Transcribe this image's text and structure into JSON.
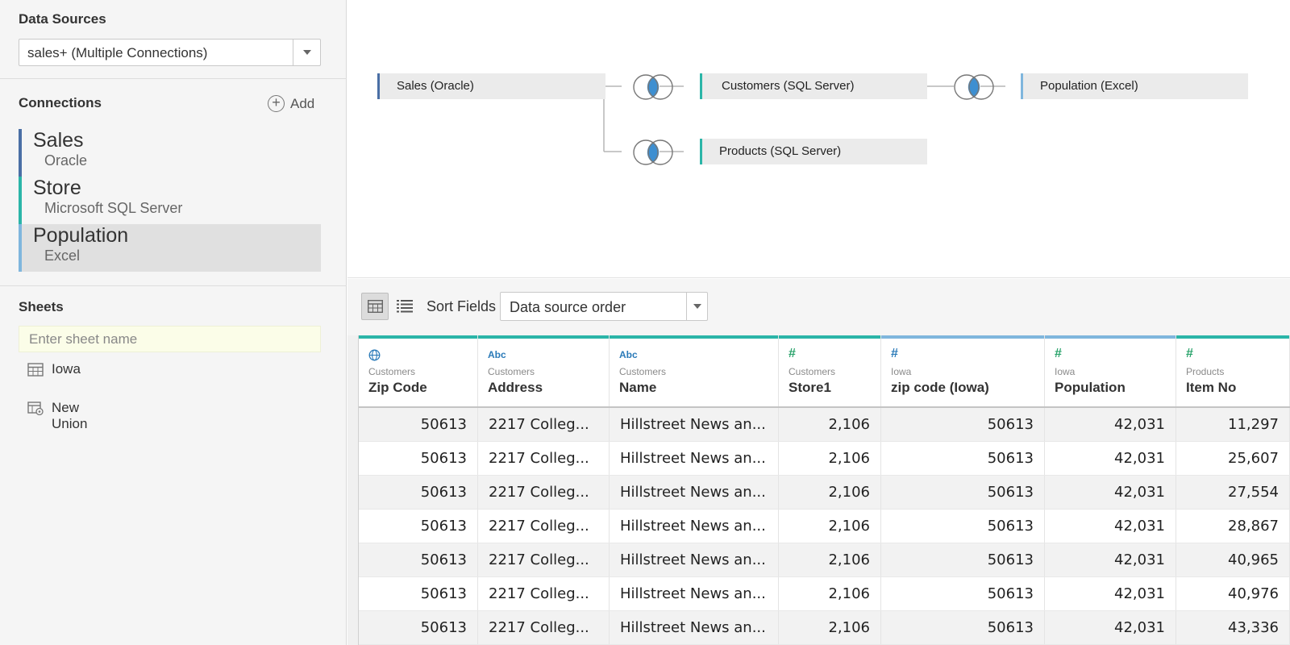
{
  "data_sources": {
    "title": "Data Sources",
    "selected": "sales+ (Multiple Connections)"
  },
  "connections": {
    "title": "Connections",
    "add_label": "Add",
    "items": [
      {
        "name": "Sales",
        "type": "Oracle",
        "color": "#4a6fa5",
        "selected": false
      },
      {
        "name": "Store",
        "type": "Microsoft SQL Server",
        "color": "#2bb5a8",
        "selected": false
      },
      {
        "name": "Population",
        "type": "Excel",
        "color": "#7fb6dd",
        "selected": true
      }
    ]
  },
  "sheets": {
    "title": "Sheets",
    "placeholder": "Enter sheet name",
    "items": [
      {
        "label": "Iowa",
        "icon": "table-icon"
      },
      {
        "label": "New Union",
        "icon": "union-icon"
      }
    ]
  },
  "join_canvas": {
    "tables": [
      {
        "label": "Sales (Oracle)",
        "color": "#4a6fa5"
      },
      {
        "label": "Customers (SQL Server)",
        "color": "#2bb5a8"
      },
      {
        "label": "Population (Excel)",
        "color": "#7fb6dd"
      },
      {
        "label": "Products (SQL Server)",
        "color": "#2bb5a8"
      }
    ],
    "join_icon": "inner-join-icon"
  },
  "toolbar": {
    "sort_label": "Sort Fields",
    "sort_value": "Data source order",
    "grid_icon": "grid-view-icon",
    "list_icon": "list-view-icon"
  },
  "grid": {
    "columns": [
      {
        "source": "Customers",
        "name": "Zip Code",
        "type": "globe",
        "type_label": "",
        "bar": "#2bb5a8",
        "type_color": "#2a7ab8"
      },
      {
        "source": "Customers",
        "name": "Address",
        "type": "abc",
        "type_label": "Abc",
        "bar": "#2bb5a8",
        "type_color": "#2a7ab8"
      },
      {
        "source": "Customers",
        "name": "Name",
        "type": "abc",
        "type_label": "Abc",
        "bar": "#2bb5a8",
        "type_color": "#2a7ab8"
      },
      {
        "source": "Customers",
        "name": "Store1",
        "type": "number",
        "type_label": "#",
        "bar": "#2bb5a8",
        "type_color": "#2aa36b"
      },
      {
        "source": "Iowa",
        "name": "zip code (Iowa)",
        "type": "number",
        "type_label": "#",
        "bar": "#7fb6dd",
        "type_color": "#2a7ab8"
      },
      {
        "source": "Iowa",
        "name": "Population",
        "type": "number",
        "type_label": "#",
        "bar": "#7fb6dd",
        "type_color": "#2aa36b"
      },
      {
        "source": "Products",
        "name": "Item No",
        "type": "number",
        "type_label": "#",
        "bar": "#2bb5a8",
        "type_color": "#2aa36b"
      }
    ],
    "rows": [
      [
        "50613",
        "2217 Colleg...",
        "Hillstreet News an...",
        "2,106",
        "50613",
        "42,031",
        "11,297"
      ],
      [
        "50613",
        "2217 Colleg...",
        "Hillstreet News an...",
        "2,106",
        "50613",
        "42,031",
        "25,607"
      ],
      [
        "50613",
        "2217 Colleg...",
        "Hillstreet News an...",
        "2,106",
        "50613",
        "42,031",
        "27,554"
      ],
      [
        "50613",
        "2217 Colleg...",
        "Hillstreet News an...",
        "2,106",
        "50613",
        "42,031",
        "28,867"
      ],
      [
        "50613",
        "2217 Colleg...",
        "Hillstreet News an...",
        "2,106",
        "50613",
        "42,031",
        "40,965"
      ],
      [
        "50613",
        "2217 Colleg...",
        "Hillstreet News an...",
        "2,106",
        "50613",
        "42,031",
        "40,976"
      ],
      [
        "50613",
        "2217 Colleg...",
        "Hillstreet News an...",
        "2,106",
        "50613",
        "42,031",
        "43,336"
      ]
    ]
  }
}
